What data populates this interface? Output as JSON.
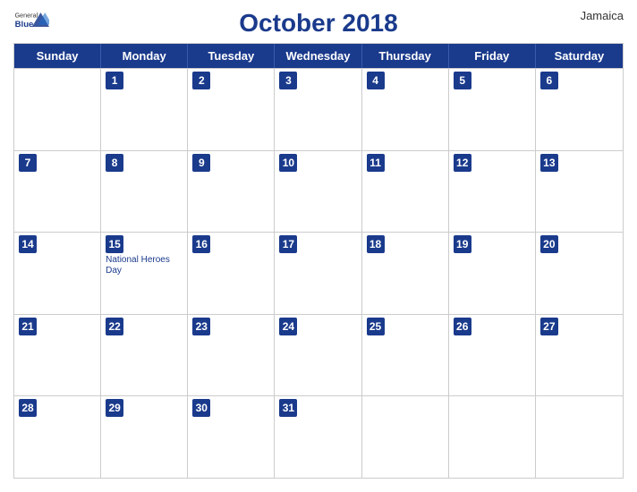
{
  "header": {
    "logo": {
      "general": "General",
      "blue": "Blue"
    },
    "title": "October 2018",
    "country": "Jamaica"
  },
  "calendar": {
    "day_headers": [
      "Sunday",
      "Monday",
      "Tuesday",
      "Wednesday",
      "Thursday",
      "Friday",
      "Saturday"
    ],
    "weeks": [
      [
        {
          "day": "",
          "holiday": ""
        },
        {
          "day": "1",
          "holiday": ""
        },
        {
          "day": "2",
          "holiday": ""
        },
        {
          "day": "3",
          "holiday": ""
        },
        {
          "day": "4",
          "holiday": ""
        },
        {
          "day": "5",
          "holiday": ""
        },
        {
          "day": "6",
          "holiday": ""
        }
      ],
      [
        {
          "day": "7",
          "holiday": ""
        },
        {
          "day": "8",
          "holiday": ""
        },
        {
          "day": "9",
          "holiday": ""
        },
        {
          "day": "10",
          "holiday": ""
        },
        {
          "day": "11",
          "holiday": ""
        },
        {
          "day": "12",
          "holiday": ""
        },
        {
          "day": "13",
          "holiday": ""
        }
      ],
      [
        {
          "day": "14",
          "holiday": ""
        },
        {
          "day": "15",
          "holiday": "National Heroes Day"
        },
        {
          "day": "16",
          "holiday": ""
        },
        {
          "day": "17",
          "holiday": ""
        },
        {
          "day": "18",
          "holiday": ""
        },
        {
          "day": "19",
          "holiday": ""
        },
        {
          "day": "20",
          "holiday": ""
        }
      ],
      [
        {
          "day": "21",
          "holiday": ""
        },
        {
          "day": "22",
          "holiday": ""
        },
        {
          "day": "23",
          "holiday": ""
        },
        {
          "day": "24",
          "holiday": ""
        },
        {
          "day": "25",
          "holiday": ""
        },
        {
          "day": "26",
          "holiday": ""
        },
        {
          "day": "27",
          "holiday": ""
        }
      ],
      [
        {
          "day": "28",
          "holiday": ""
        },
        {
          "day": "29",
          "holiday": ""
        },
        {
          "day": "30",
          "holiday": ""
        },
        {
          "day": "31",
          "holiday": ""
        },
        {
          "day": "",
          "holiday": ""
        },
        {
          "day": "",
          "holiday": ""
        },
        {
          "day": "",
          "holiday": ""
        }
      ]
    ]
  }
}
